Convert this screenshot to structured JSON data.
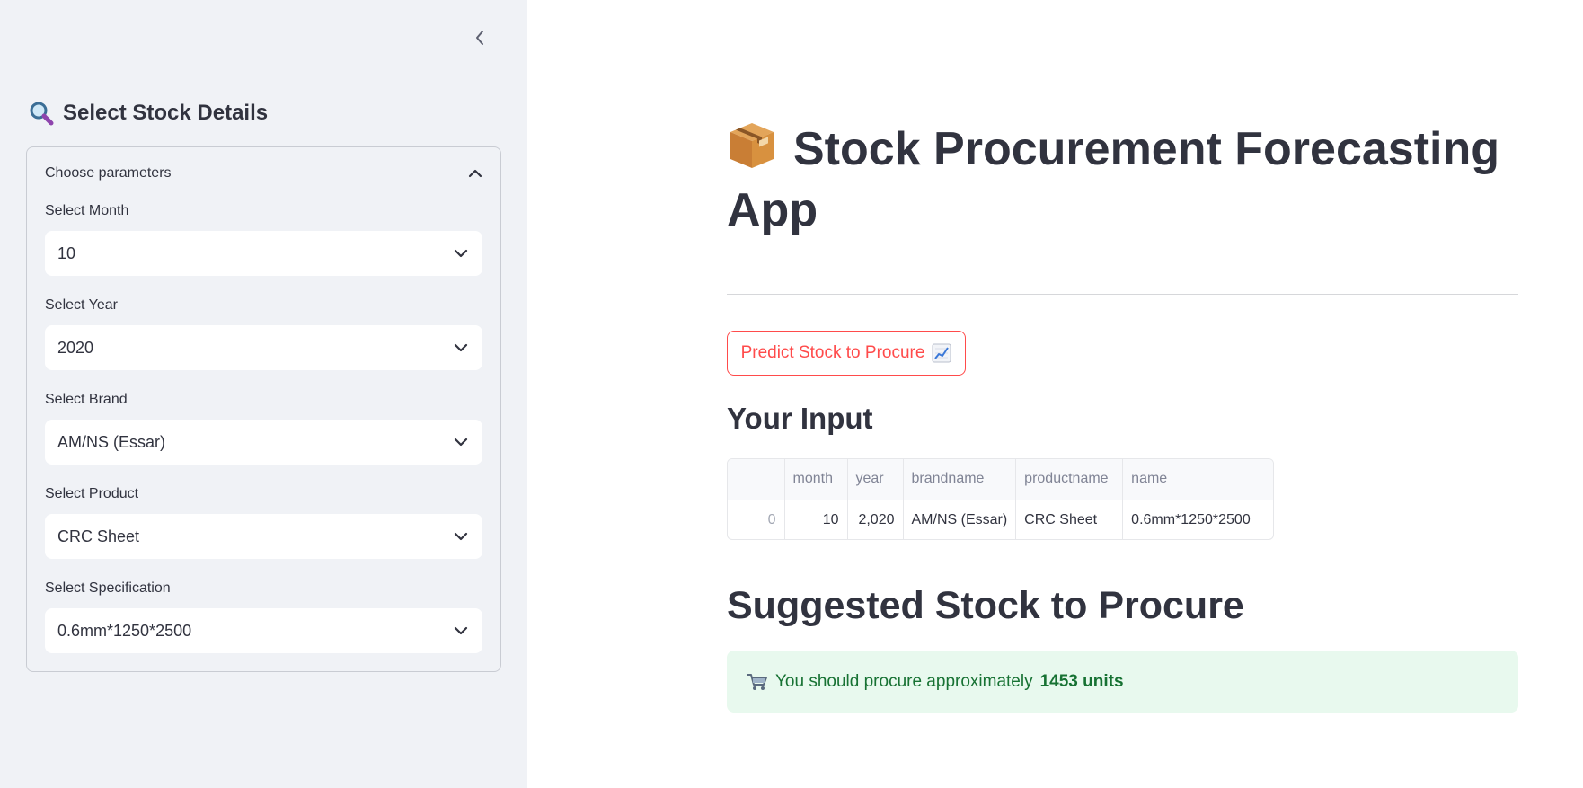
{
  "sidebar": {
    "title": "Select Stock Details",
    "expander": {
      "label": "Choose parameters",
      "fields": [
        {
          "label": "Select Month",
          "value": "10"
        },
        {
          "label": "Select Year",
          "value": "2020"
        },
        {
          "label": "Select Brand",
          "value": "AM/NS (Essar)"
        },
        {
          "label": "Select Product",
          "value": "CRC Sheet"
        },
        {
          "label": "Select Specification",
          "value": "0.6mm*1250*2500"
        }
      ]
    }
  },
  "main": {
    "title": "Stock Procurement Forecasting App",
    "predict_button": "Predict Stock to Procure",
    "your_input_heading": "Your Input",
    "table": {
      "columns": [
        "",
        "month",
        "year",
        "brandname",
        "productname",
        "name"
      ],
      "rows": [
        [
          "0",
          "10",
          "2,020",
          "AM/NS (Essar)",
          "CRC Sheet",
          "0.6mm*1250*2500"
        ]
      ]
    },
    "suggested_heading": "Suggested Stock to Procure",
    "alert": {
      "prefix": "You should procure approximately",
      "amount": "1453 units"
    }
  },
  "colors": {
    "sidebar_bg": "#f0f2f6",
    "primary": "#ff4b4b",
    "text": "#31333f",
    "success_bg": "#e8f9ee",
    "success_text": "#177233"
  },
  "icons": {
    "sidebar_title": "magnifier-icon",
    "title": "package-icon",
    "predict_button": "chart-increasing-icon",
    "alert": "shopping-cart-icon"
  }
}
